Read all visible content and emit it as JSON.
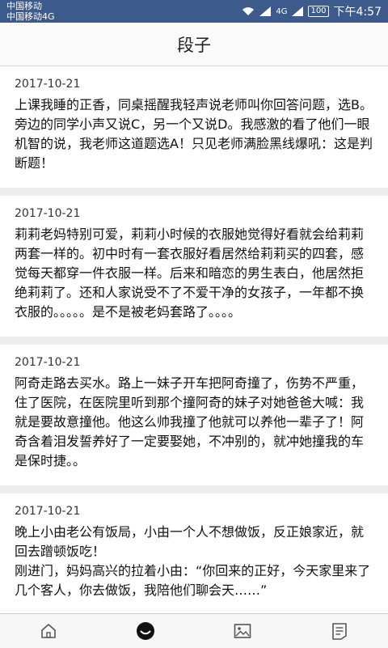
{
  "status_bar": {
    "carrier1": "中国移动",
    "carrier2": "中国移动4G",
    "net_type": "4G",
    "battery": "100",
    "time": "下午4:57"
  },
  "header": {
    "title": "段子"
  },
  "posts": [
    {
      "date": "2017-10-21",
      "text": "上课我睡的正香，同桌摇醒我轻声说老师叫你回答问题，选B。旁边的同学小声又说C，另一个又说D。我感激的看了他们一眼机智的说，我老师这道题选A！只见老师满脸黑线爆吼：这是判断题！"
    },
    {
      "date": "2017-10-21",
      "text": "莉莉老妈特别可爱，莉莉小时候的衣服她觉得好看就会给莉莉两套一样的。初中时有一套衣服好看居然给莉莉买的四套，感觉每天都穿一件衣服一样。后来和暗恋的男生表白，他居然拒绝莉莉了。还和人家说受不了不爱干净的女孩子，一年都不换衣服的。。。。。是不是被老妈套路了。。。。"
    },
    {
      "date": "2017-10-21",
      "text": "阿奇走路去买水。路上一妹子开车把阿奇撞了，伤势不严重，住了医院，在医院里听到那个撞阿奇的妹子对她爸爸大喊：我就是要故意撞他。他这么帅我撞了他就可以养他一辈子了！阿奇含着泪发誓养好了一定要娶她，不冲别的，就冲她撞我的车是保时捷。。"
    },
    {
      "date": "2017-10-21",
      "text": "晚上小由老公有饭局，小由一个人不想做饭，反正娘家近，就回去蹭顿饭吃！\n刚进门，妈妈高兴的拉着小由：“你回来的正好，今天家里来了几个客人，你去做饭，我陪他们聊会天……”"
    }
  ],
  "tabs": [
    {
      "icon": "home-icon"
    },
    {
      "icon": "smile-icon"
    },
    {
      "icon": "picture-icon"
    },
    {
      "icon": "document-icon"
    }
  ],
  "colors": {
    "status_bar": "#3c5a8c",
    "background": "#ececec",
    "card": "#ffffff"
  }
}
